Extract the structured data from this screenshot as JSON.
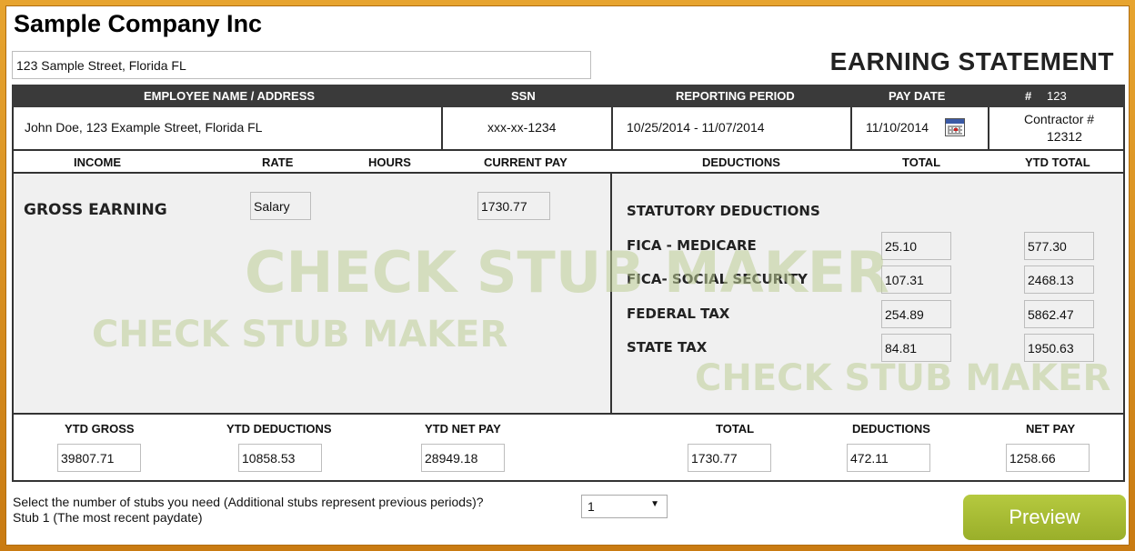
{
  "company": "Sample Company Inc",
  "company_address": "123 Sample Street, Florida FL",
  "title": "EARNING STATEMENT",
  "header": {
    "employee": "EMPLOYEE NAME / ADDRESS",
    "ssn": "SSN",
    "period": "REPORTING PERIOD",
    "pay_date": "PAY DATE",
    "hash": "#",
    "number": "123"
  },
  "employee_row": {
    "name_address": "John Doe, 123 Example Street, Florida FL",
    "ssn": "xxx-xx-1234",
    "period": "10/25/2014 - 11/07/2014",
    "pay_date": "11/10/2014",
    "contractor_label": "Contractor #",
    "contractor_no": "12312"
  },
  "columns": {
    "income": "INCOME",
    "rate": "RATE",
    "hours": "HOURS",
    "current_pay": "CURRENT PAY",
    "deductions": "DEDUCTIONS",
    "total": "TOTAL",
    "ytd_total": "YTD TOTAL"
  },
  "income": {
    "label": "GROSS EARNING",
    "rate": "Salary",
    "current_pay": "1730.77"
  },
  "deductions": {
    "heading": "STATUTORY DEDUCTIONS",
    "items": [
      {
        "label": "FICA - MEDICARE",
        "total": "25.10",
        "ytd": "577.30"
      },
      {
        "label": "FICA- SOCIAL SECURITY",
        "total": "107.31",
        "ytd": "2468.13"
      },
      {
        "label": "FEDERAL TAX",
        "total": "254.89",
        "ytd": "5862.47"
      },
      {
        "label": "STATE TAX",
        "total": "84.81",
        "ytd": "1950.63"
      }
    ]
  },
  "watermark": "CHECK STUB MAKER",
  "totals": {
    "ytd_gross_label": "YTD GROSS",
    "ytd_gross": "39807.71",
    "ytd_deductions_label": "YTD DEDUCTIONS",
    "ytd_deductions": "10858.53",
    "ytd_net_label": "YTD NET PAY",
    "ytd_net": "28949.18",
    "total_label": "TOTAL",
    "total": "1730.77",
    "deductions_label": "DEDUCTIONS",
    "deductions": "472.11",
    "net_label": "NET PAY",
    "net": "1258.66"
  },
  "footer": {
    "prompt": "Select the number of stubs you need (Additional stubs represent previous periods)?",
    "stub_note": "Stub 1 (The most recent paydate)",
    "stubs_value": "1",
    "preview_label": "Preview"
  },
  "colors": {
    "frame": "#d88a1c",
    "header_bar": "#3a3a3a",
    "preview_button": "#a8bd33",
    "watermark": "#bfcd96"
  }
}
